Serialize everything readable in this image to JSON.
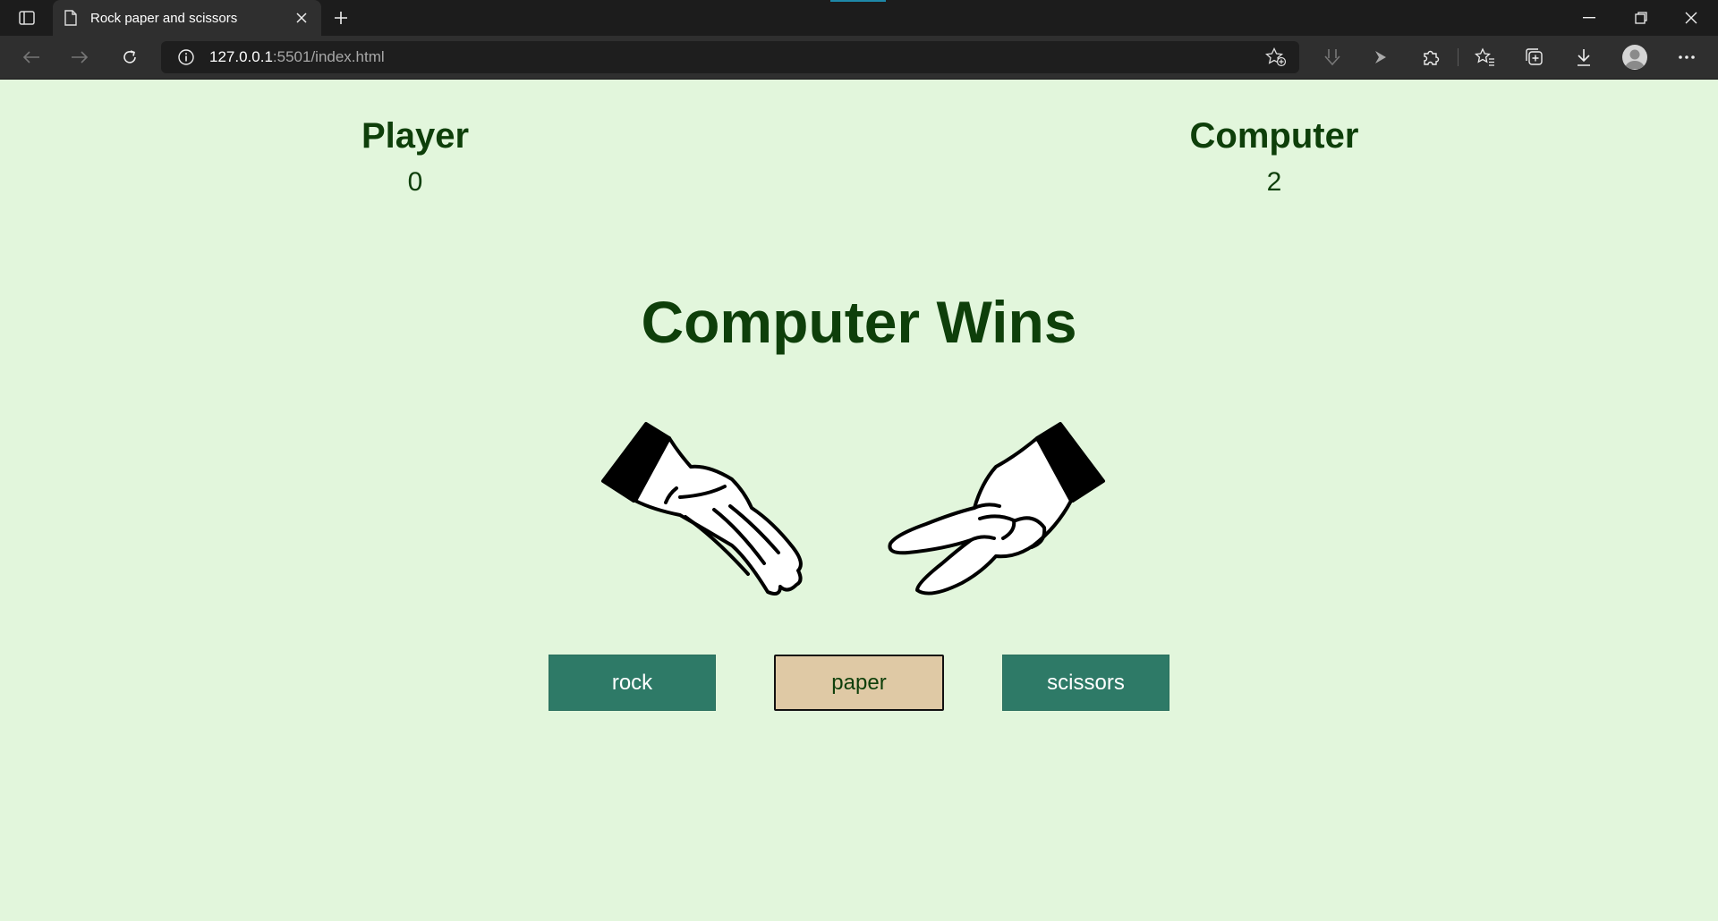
{
  "browser": {
    "tab_title": "Rock paper and scissors",
    "url_host": "127.0.0.1",
    "url_rest": ":5501/index.html",
    "icons": [
      "tab-actions-icon",
      "document-icon",
      "close-icon",
      "new-tab-icon",
      "minimize-icon",
      "restore-icon",
      "window-close-icon",
      "back-icon",
      "forward-icon",
      "refresh-icon",
      "site-info-icon",
      "add-favorite-icon",
      "collections-download-icon",
      "media-icon",
      "extensions-icon",
      "favorites-icon",
      "collections-icon",
      "downloads-icon",
      "profile-icon",
      "more-icon"
    ]
  },
  "scores": {
    "player_label": "Player",
    "player_score": "0",
    "computer_label": "Computer",
    "computer_score": "2"
  },
  "result_text": "Computer Wins",
  "hands": {
    "player_choice": "paper",
    "computer_choice": "scissors"
  },
  "buttons": {
    "rock": "rock",
    "paper": "paper",
    "scissors": "scissors",
    "selected": "paper"
  },
  "colors": {
    "page_background": "#e2f6dc",
    "text": "#0e3f0a",
    "button_green": "#2e7a67",
    "button_selected": "#dfc9a5"
  }
}
